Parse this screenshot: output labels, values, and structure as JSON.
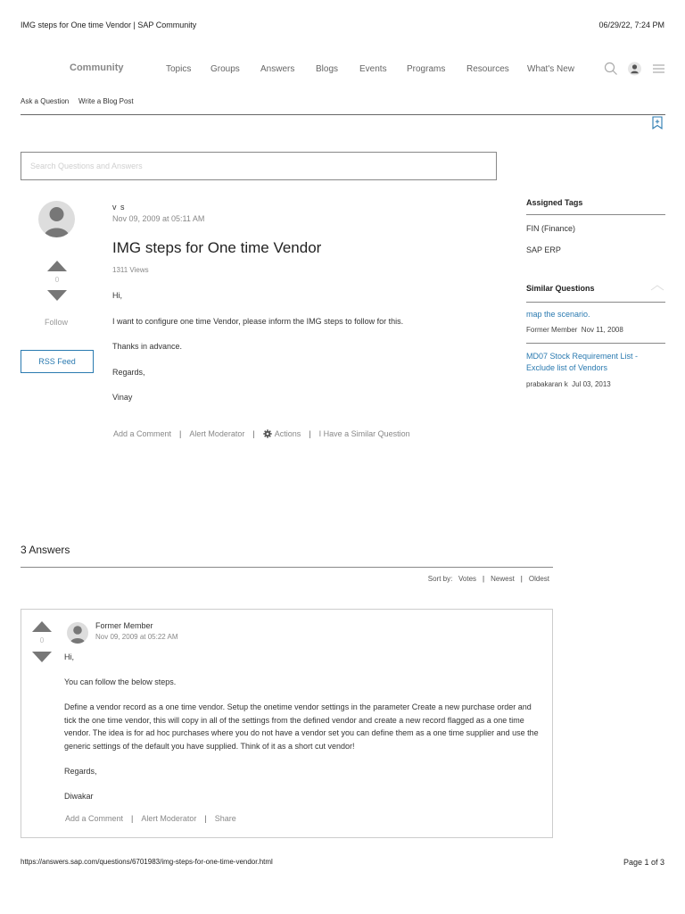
{
  "print_header": {
    "title": "IMG steps for One time Vendor | SAP Community",
    "datetime": "06/29/22, 7:24 PM"
  },
  "nav": {
    "brand": "Community",
    "items": [
      "Topics",
      "Groups",
      "Answers",
      "Blogs",
      "Events",
      "Programs",
      "Resources",
      "What's New"
    ],
    "icons": [
      "search-icon",
      "user-icon",
      "menu-icon"
    ]
  },
  "subnav": {
    "ask": "Ask a Question",
    "write": "Write a Blog Post"
  },
  "search": {
    "placeholder": "Search Questions and Answers",
    "value": ""
  },
  "question": {
    "author": "v s",
    "date": "Nov 09, 2009 at 05:11 AM",
    "title": "IMG steps for One time Vendor",
    "views": "1311 Views",
    "votes": "0",
    "body": [
      "Hi,",
      "I want to configure one time Vendor, please inform the IMG steps to follow for this.",
      "Thanks in advance.",
      "Regards,",
      "Vinay"
    ],
    "actions": {
      "comment": "Add a Comment",
      "alert": "Alert Moderator",
      "more": "Actions",
      "similar": "I Have a Similar Question"
    }
  },
  "left_actions": {
    "follow": "Follow",
    "rss": "RSS Feed"
  },
  "sidebar": {
    "tags_heading": "Assigned Tags",
    "tags": [
      "FIN (Finance)",
      "SAP ERP"
    ],
    "similar_heading": "Similar Questions",
    "similar": [
      {
        "title": "map the scenario.",
        "author": "Former Member",
        "date": "Nov 11, 2008"
      },
      {
        "title": "MD07 Stock Requirement List - Exclude list of Vendors",
        "author": "prabakaran k",
        "date": "Jul 03, 2013"
      }
    ]
  },
  "answers": {
    "count_label": "3 Answers",
    "sort": {
      "label": "Sort by:",
      "options": [
        "Votes",
        "Newest",
        "Oldest"
      ]
    },
    "items": [
      {
        "author": "Former Member",
        "date": "Nov 09, 2009 at 05:22 AM",
        "votes": "0",
        "body": [
          "Hi,",
          "You can follow the below steps.",
          "Define a vendor record as a one time vendor. Setup the onetime vendor settings in the parameter Create a new purchase order and tick the one time vendor, this will copy in all of the settings from the defined vendor and create a new record flagged as a one time vendor. The idea is for ad hoc purchases where you do not have a vendor set you can define them as a one time supplier and use the generic settings of the default you have supplied. Think of it as a short cut vendor!",
          "Regards,",
          "Diwakar"
        ],
        "actions": {
          "comment": "Add a Comment",
          "alert": "Alert Moderator",
          "share": "Share"
        }
      }
    ]
  },
  "print_footer": {
    "url": "https://answers.sap.com/questions/6701983/img-steps-for-one-time-vendor.html",
    "page": "Page 1 of 3"
  },
  "colors": {
    "link": "#2a7ab0",
    "muted": "#888888",
    "border": "#cccccc"
  }
}
